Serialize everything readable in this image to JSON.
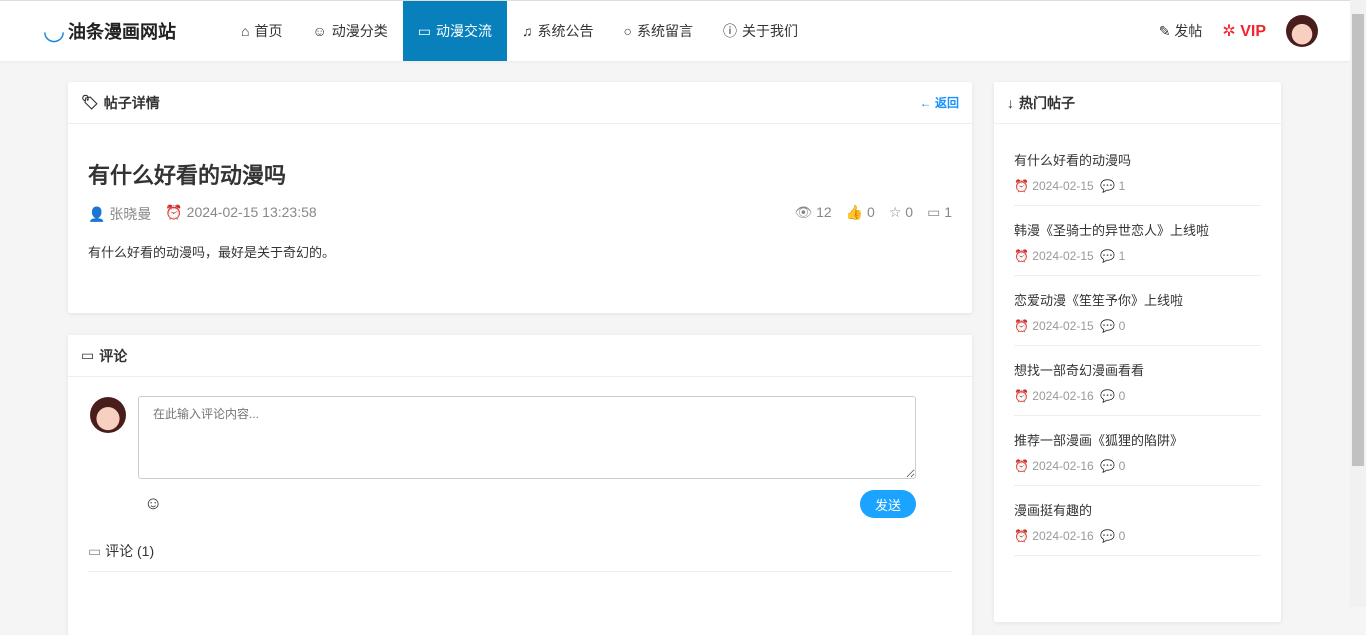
{
  "site": {
    "name": "油条漫画网站"
  },
  "nav": {
    "items": [
      "首页",
      "动漫分类",
      "动漫交流",
      "系统公告",
      "系统留言",
      "关于我们"
    ],
    "active": 2,
    "post": "发帖",
    "vip": "VIP"
  },
  "detail": {
    "header": "帖子详情",
    "back": "返回",
    "title": "有什么好看的动漫吗",
    "author": "张晓曼",
    "time": "2024-02-15 13:23:58",
    "views": "12",
    "likes": "0",
    "favs": "0",
    "comments": "1",
    "content": "有什么好看的动漫吗，最好是关于奇幻的。"
  },
  "comment": {
    "header": "评论",
    "placeholder": "在此输入评论内容...",
    "send": "发送",
    "count_label": "评论 (1)"
  },
  "hot": {
    "header": "热门帖子",
    "items": [
      {
        "title": "有什么好看的动漫吗",
        "date": "2024-02-15",
        "count": "1"
      },
      {
        "title": "韩漫《圣骑士的异世恋人》上线啦",
        "date": "2024-02-15",
        "count": "1"
      },
      {
        "title": "恋爱动漫《笙笙予你》上线啦",
        "date": "2024-02-15",
        "count": "0"
      },
      {
        "title": "想找一部奇幻漫画看看",
        "date": "2024-02-16",
        "count": "0"
      },
      {
        "title": "推荐一部漫画《狐狸的陷阱》",
        "date": "2024-02-16",
        "count": "0"
      },
      {
        "title": "漫画挺有趣的",
        "date": "2024-02-16",
        "count": "0"
      }
    ]
  }
}
